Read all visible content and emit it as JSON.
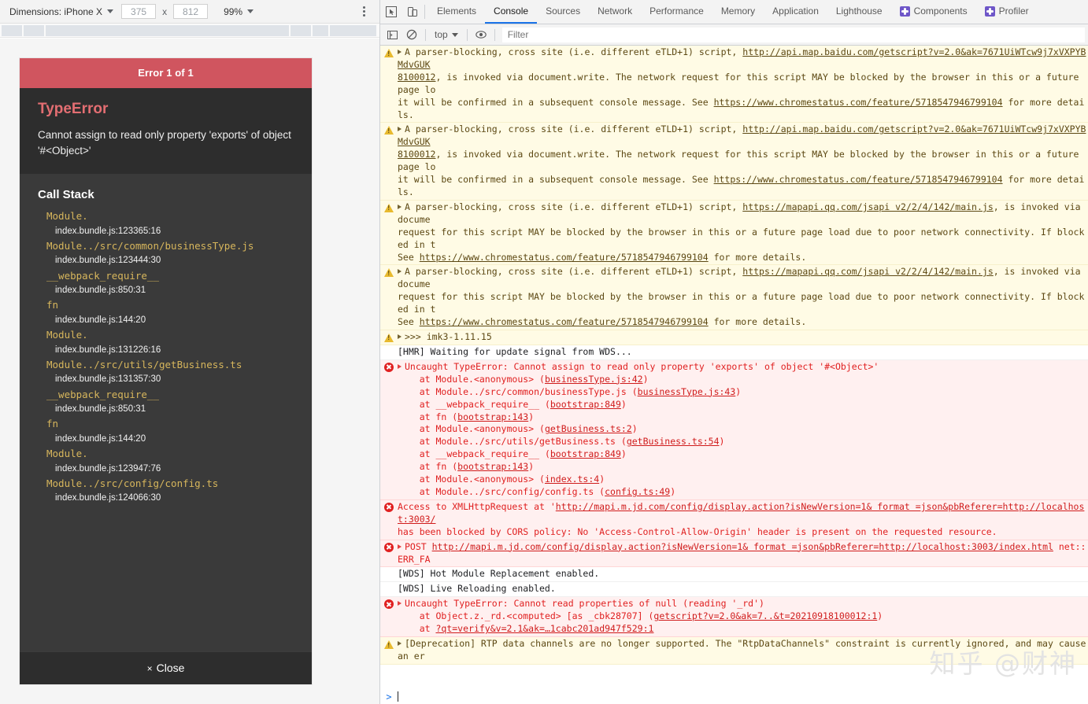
{
  "device_toolbar": {
    "dimensions_label": "Dimensions: iPhone X",
    "width_value": "375",
    "multiply": "x",
    "height_value": "812",
    "zoom_label": "99%",
    "more_options_icon": "kebab-menu-icon"
  },
  "error_overlay": {
    "header": "Error 1 of 1",
    "error_type": "TypeError",
    "error_message": "Cannot assign to read only property 'exports' of object '#<Object>'",
    "call_stack_title": "Call Stack",
    "frames": [
      {
        "fn": "Module.",
        "loc": "index.bundle.js:123365:16"
      },
      {
        "fn": "Module../src/common/businessType.js",
        "loc": "index.bundle.js:123444:30"
      },
      {
        "fn": "__webpack_require__",
        "loc": "index.bundle.js:850:31"
      },
      {
        "fn": "fn",
        "loc": "index.bundle.js:144:20"
      },
      {
        "fn": "Module.",
        "loc": "index.bundle.js:131226:16"
      },
      {
        "fn": "Module../src/utils/getBusiness.ts",
        "loc": "index.bundle.js:131357:30"
      },
      {
        "fn": "__webpack_require__",
        "loc": "index.bundle.js:850:31"
      },
      {
        "fn": "fn",
        "loc": "index.bundle.js:144:20"
      },
      {
        "fn": "Module.",
        "loc": "index.bundle.js:123947:76"
      },
      {
        "fn": "Module../src/config/config.ts",
        "loc": "index.bundle.js:124066:30"
      }
    ],
    "close_label": "Close",
    "close_glyph": "×",
    "header_color": "#d0555f",
    "type_color": "#e36e72"
  },
  "devtools": {
    "inspect_icon": "inspect-element-icon",
    "device_toolbar_icon": "toggle-device-toolbar-icon",
    "tabs": [
      {
        "label": "Elements",
        "active": false,
        "badge": false
      },
      {
        "label": "Console",
        "active": true,
        "badge": false
      },
      {
        "label": "Sources",
        "active": false,
        "badge": false
      },
      {
        "label": "Network",
        "active": false,
        "badge": false
      },
      {
        "label": "Performance",
        "active": false,
        "badge": false
      },
      {
        "label": "Memory",
        "active": false,
        "badge": false
      },
      {
        "label": "Application",
        "active": false,
        "badge": false
      },
      {
        "label": "Lighthouse",
        "active": false,
        "badge": false
      },
      {
        "label": "Components",
        "active": false,
        "badge": true
      },
      {
        "label": "Profiler",
        "active": false,
        "badge": true
      }
    ],
    "console_toolbar": {
      "sidebar_icon": "console-sidebar-icon",
      "clear_icon": "clear-console-icon",
      "context_label": "top",
      "eye_icon": "live-expression-icon",
      "filter_placeholder": "Filter"
    },
    "prompt_symbol": ">"
  },
  "console_messages": [
    {
      "level": "warn",
      "expandable": true,
      "lines": [
        [
          {
            "t": "A parser-blocking, cross site (i.e. different eTLD+1) script, "
          },
          {
            "t": "http://api.map.baidu.com/getscript?v=2.0&ak=7671UiWTcw9j7xVXPYBMdvGUK",
            "link": true
          },
          {
            "t": ""
          }
        ],
        [
          {
            "t": "8100012",
            "link": true
          },
          {
            "t": ", is invoked via document.write. The network request for this script MAY be blocked by the browser in this or a future page lo"
          }
        ],
        [
          {
            "t": "it will be confirmed in a subsequent console message. See "
          },
          {
            "t": "https://www.chromestatus.com/feature/5718547946799104",
            "link": true
          },
          {
            "t": " for more details."
          }
        ]
      ]
    },
    {
      "level": "warn",
      "expandable": true,
      "lines": [
        [
          {
            "t": "A parser-blocking, cross site (i.e. different eTLD+1) script, "
          },
          {
            "t": "http://api.map.baidu.com/getscript?v=2.0&ak=7671UiWTcw9j7xVXPYBMdvGUK",
            "link": true
          }
        ],
        [
          {
            "t": "8100012",
            "link": true
          },
          {
            "t": ", is invoked via document.write. The network request for this script MAY be blocked by the browser in this or a future page lo"
          }
        ],
        [
          {
            "t": "it will be confirmed in a subsequent console message. See "
          },
          {
            "t": "https://www.chromestatus.com/feature/5718547946799104",
            "link": true
          },
          {
            "t": " for more details."
          }
        ]
      ]
    },
    {
      "level": "warn",
      "expandable": true,
      "lines": [
        [
          {
            "t": "A parser-blocking, cross site (i.e. different eTLD+1) script, "
          },
          {
            "t": "https://mapapi.qq.com/jsapi v2/2/4/142/main.js",
            "link": true
          },
          {
            "t": ", is invoked via docume"
          }
        ],
        [
          {
            "t": "request for this script MAY be blocked by the browser in this or a future page load due to poor network connectivity. If blocked in t"
          }
        ],
        [
          {
            "t": "See "
          },
          {
            "t": "https://www.chromestatus.com/feature/5718547946799104",
            "link": true
          },
          {
            "t": " for more details."
          }
        ]
      ]
    },
    {
      "level": "warn",
      "expandable": true,
      "lines": [
        [
          {
            "t": "A parser-blocking, cross site (i.e. different eTLD+1) script, "
          },
          {
            "t": "https://mapapi.qq.com/jsapi v2/2/4/142/main.js",
            "link": true
          },
          {
            "t": ", is invoked via docume"
          }
        ],
        [
          {
            "t": "request for this script MAY be blocked by the browser in this or a future page load due to poor network connectivity. If blocked in t"
          }
        ],
        [
          {
            "t": "See "
          },
          {
            "t": "https://www.chromestatus.com/feature/5718547946799104",
            "link": true
          },
          {
            "t": " for more details."
          }
        ]
      ]
    },
    {
      "level": "warn",
      "expandable": true,
      "lines": [
        [
          {
            "t": ">>> imk3-1.11.15"
          }
        ]
      ]
    },
    {
      "level": "info",
      "expandable": false,
      "lines": [
        [
          {
            "t": "[HMR] Waiting for update signal from WDS..."
          }
        ]
      ]
    },
    {
      "level": "err",
      "expandable": true,
      "lines": [
        [
          {
            "t": "Uncaught TypeError: Cannot assign to read only property 'exports' of object '#<Object>'"
          }
        ],
        [
          {
            "t": "    at Module.<anonymous> (",
            "indent": true
          },
          {
            "t": "businessType.js:42",
            "link": true
          },
          {
            "t": ")"
          }
        ],
        [
          {
            "t": "    at Module../src/common/businessType.js (",
            "indent": true
          },
          {
            "t": "businessType.js:43",
            "link": true
          },
          {
            "t": ")"
          }
        ],
        [
          {
            "t": "    at __webpack_require__ (",
            "indent": true
          },
          {
            "t": "bootstrap:849",
            "link": true
          },
          {
            "t": ")"
          }
        ],
        [
          {
            "t": "    at fn (",
            "indent": true
          },
          {
            "t": "bootstrap:143",
            "link": true
          },
          {
            "t": ")"
          }
        ],
        [
          {
            "t": "    at Module.<anonymous> (",
            "indent": true
          },
          {
            "t": "getBusiness.ts:2",
            "link": true
          },
          {
            "t": ")"
          }
        ],
        [
          {
            "t": "    at Module../src/utils/getBusiness.ts (",
            "indent": true
          },
          {
            "t": "getBusiness.ts:54",
            "link": true
          },
          {
            "t": ")"
          }
        ],
        [
          {
            "t": "    at __webpack_require__ (",
            "indent": true
          },
          {
            "t": "bootstrap:849",
            "link": true
          },
          {
            "t": ")"
          }
        ],
        [
          {
            "t": "    at fn (",
            "indent": true
          },
          {
            "t": "bootstrap:143",
            "link": true
          },
          {
            "t": ")"
          }
        ],
        [
          {
            "t": "    at Module.<anonymous> (",
            "indent": true
          },
          {
            "t": "index.ts:4",
            "link": true
          },
          {
            "t": ")"
          }
        ],
        [
          {
            "t": "    at Module../src/config/config.ts (",
            "indent": true
          },
          {
            "t": "config.ts:49",
            "link": true
          },
          {
            "t": ")"
          }
        ]
      ]
    },
    {
      "level": "err",
      "expandable": false,
      "lines": [
        [
          {
            "t": "Access to XMLHttpRequest at '"
          },
          {
            "t": "http://mapi.m.jd.com/config/display.action?isNewVersion=1& format =json&pbReferer=http://localhost:3003/",
            "link": true
          }
        ],
        [
          {
            "t": "has been blocked by CORS policy: No 'Access-Control-Allow-Origin' header is present on the requested resource."
          }
        ]
      ]
    },
    {
      "level": "err",
      "expandable": true,
      "lines": [
        [
          {
            "t": "POST "
          },
          {
            "t": "http://mapi.m.jd.com/config/display.action?isNewVersion=1& format =json&pbReferer=http://localhost:3003/index.html",
            "link": true
          },
          {
            "t": " net::ERR_FA"
          }
        ]
      ]
    },
    {
      "level": "info",
      "expandable": false,
      "lines": [
        [
          {
            "t": "[WDS] Hot Module Replacement enabled."
          }
        ]
      ]
    },
    {
      "level": "info",
      "expandable": false,
      "lines": [
        [
          {
            "t": "[WDS] Live Reloading enabled."
          }
        ]
      ]
    },
    {
      "level": "err",
      "expandable": true,
      "lines": [
        [
          {
            "t": "Uncaught TypeError: Cannot read properties of null (reading '_rd')"
          }
        ],
        [
          {
            "t": "    at Object.z._rd.<computed> [as _cbk28707] (",
            "indent": true
          },
          {
            "t": "getscript?v=2.0&ak=7..&t=20210918100012:1",
            "link": true
          },
          {
            "t": ")"
          }
        ],
        [
          {
            "t": "    at ",
            "indent": true
          },
          {
            "t": "?qt=verify&v=2.1&ak=…1cabc201ad947f529:1",
            "link": true
          }
        ]
      ]
    },
    {
      "level": "warn",
      "expandable": true,
      "lines": [
        [
          {
            "t": "[Deprecation] RTP data channels are no longer supported. The \"RtpDataChannels\" constraint is currently ignored, and may cause an er"
          }
        ]
      ]
    }
  ],
  "watermark": "知乎 @财神"
}
